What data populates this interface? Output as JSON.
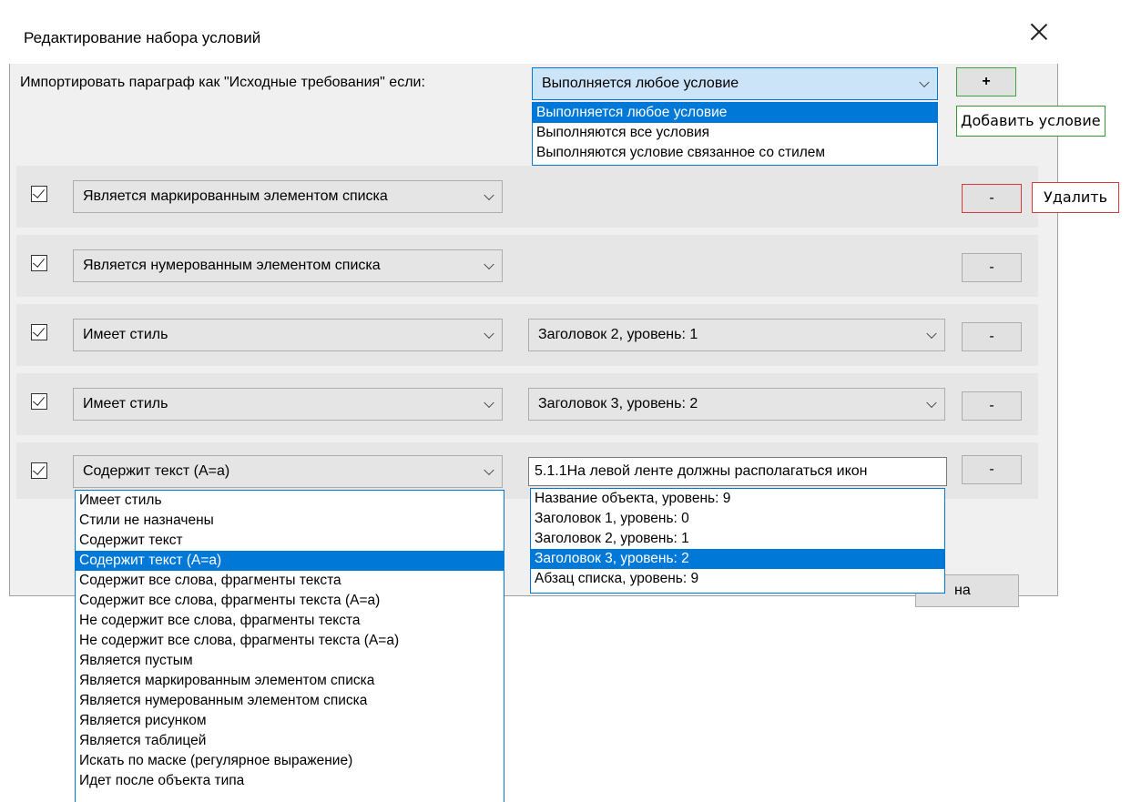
{
  "dialog": {
    "title": "Редактирование набора условий",
    "import_label": "Импортировать параграф как \"Исходные требования\" если:",
    "mode_selected": "Выполняется любое условие",
    "mode_options": [
      "Выполняется любое условие",
      "Выполняются все условия",
      "Выполняются условие связанное со стилем"
    ],
    "add_button": "+",
    "add_tooltip": "Добавить условие",
    "remove_tooltip": "Удалить",
    "ok_button_partial": "на"
  },
  "rows": [
    {
      "checked": true,
      "condition": "Является маркированным элементом списка",
      "remove": "-"
    },
    {
      "checked": true,
      "condition": "Является нумерованным элементом списка",
      "remove": "-"
    },
    {
      "checked": true,
      "condition": "Имеет стиль",
      "value": "Заголовок 2, уровень: 1",
      "remove": "-"
    },
    {
      "checked": true,
      "condition": "Имеет стиль",
      "value": "Заголовок 3, уровень: 2",
      "remove": "-"
    },
    {
      "checked": true,
      "condition": "Содержит текст (A=a)",
      "value": "5.1.1На левой ленте должны располагаться икон",
      "remove": "-"
    }
  ],
  "condition_options": [
    "Имеет стиль",
    "Стили не назначены",
    "Содержит текст",
    "Содержит текст (A=a)",
    "Содержит все слова, фрагменты текста",
    "Содержит все слова, фрагменты текста (A=a)",
    "Не содержит все слова, фрагменты текста",
    "Не содержит все слова, фрагменты текста (A=a)",
    "Является пустым",
    "Является маркированным элементом списка",
    "Является нумерованным элементом списка",
    "Является рисунком",
    "Является таблицей",
    "Искать по маске (регулярное выражение)",
    "Идет после объекта типа"
  ],
  "condition_selected_index": 3,
  "style_options": [
    "Название объекта, уровень: 9",
    "Заголовок 1, уровень: 0",
    "Заголовок 2, уровень: 1",
    "Заголовок 3, уровень: 2",
    "Абзац списка, уровень: 9"
  ],
  "style_selected_index": 3,
  "colors": {
    "accent": "#0078d7",
    "add_highlight": "#2e9a2e",
    "remove_highlight": "#d63a3a"
  },
  "icons": {
    "close": "close-icon",
    "chevron": "chevron-down-icon",
    "check": "checkbox-checked-icon"
  }
}
